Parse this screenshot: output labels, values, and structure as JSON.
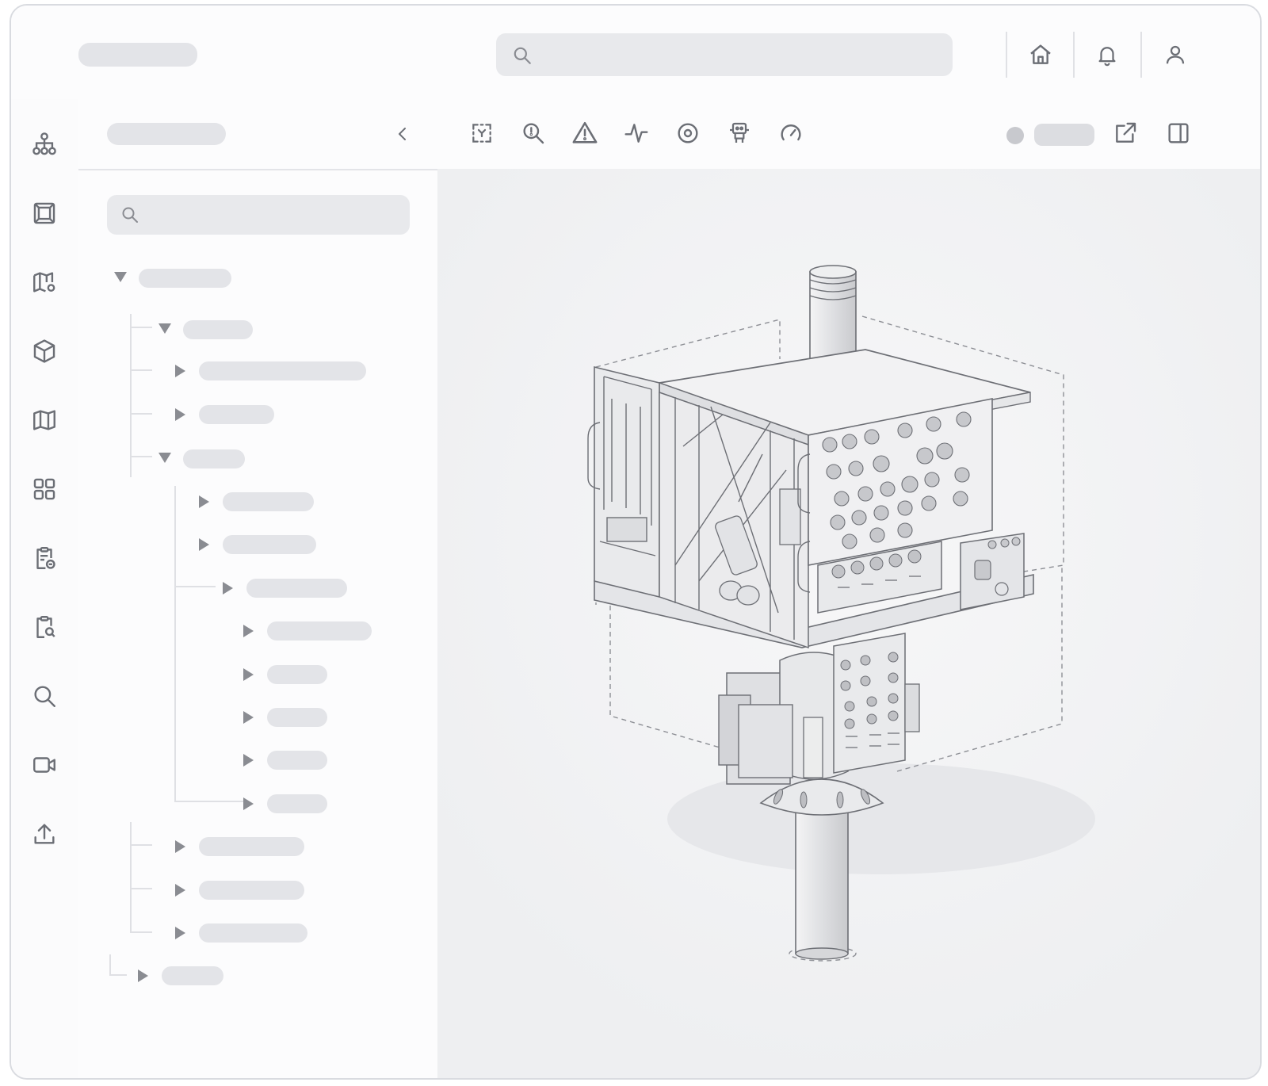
{
  "topbar": {
    "icons": [
      "search-icon",
      "home-icon",
      "bell-icon",
      "user-icon"
    ]
  },
  "rail": {
    "icons": [
      "hierarchy-icon",
      "frame-icon",
      "map-pin-icon",
      "cube-icon",
      "map-icon",
      "grid-icon",
      "clipboard-list-icon",
      "clipboard-search-icon",
      "search-icon",
      "video-icon",
      "upload-icon"
    ]
  },
  "tree_panel": {
    "icons": [
      "chevron-left-icon",
      "search-icon"
    ]
  },
  "viewer": {
    "toolbar_icons": [
      "select-region-icon",
      "zoom-icon",
      "warning-icon",
      "signal-icon",
      "target-icon",
      "robot-icon",
      "gauge-icon",
      "external-link-icon",
      "side-panel-icon"
    ]
  },
  "colors": {
    "frame_border": "#d9dbe0",
    "placeholder": "#e3e4e8",
    "icon": "#6b6e75",
    "viewer_bg": "#f1f2f4"
  }
}
